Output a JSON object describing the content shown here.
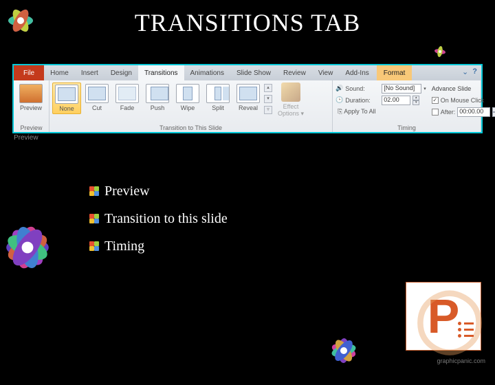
{
  "title": "TRANSITIONS TAB",
  "ribbon": {
    "file": "File",
    "tabs": [
      "Home",
      "Insert",
      "Design",
      "Transitions",
      "Animations",
      "Slide Show",
      "Review",
      "View",
      "Add-Ins"
    ],
    "active_tab": "Transitions",
    "format_tab": "Format",
    "preview_group": {
      "label": "Preview",
      "button": "Preview"
    },
    "gallery": {
      "items": [
        "None",
        "Cut",
        "Fade",
        "Push",
        "Wipe",
        "Split",
        "Reveal"
      ],
      "selected": "None",
      "group_label": "Transition to This Slide",
      "effect_options": "Effect Options ▾"
    },
    "timing": {
      "sound_label": "Sound:",
      "sound_value": "[No Sound]",
      "duration_label": "Duration:",
      "duration_value": "02.00",
      "apply_label": "Apply To All",
      "advance_heading": "Advance Slide",
      "on_click_label": "On Mouse Click",
      "on_click_checked": true,
      "after_label": "After:",
      "after_value": "00:00.00",
      "after_checked": false,
      "group_label": "Timing"
    },
    "under_preview": "Preview"
  },
  "bullets": [
    "Preview",
    "Transition to this slide",
    "Timing"
  ],
  "watermark": "graphicpanic.com"
}
